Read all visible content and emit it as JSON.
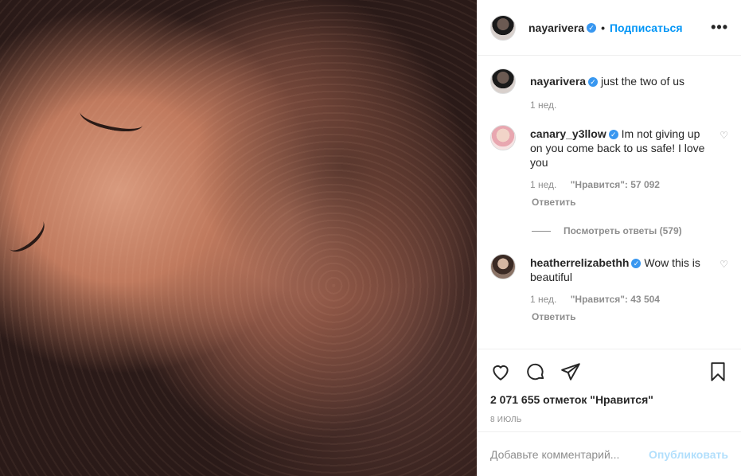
{
  "header": {
    "username": "nayarivera",
    "separator": "•",
    "follow_label": "Подписаться",
    "more": "•••"
  },
  "caption": {
    "username": "nayarivera",
    "text": "just the two of us",
    "time": "1 нед."
  },
  "comments": [
    {
      "username": "canary_y3llow",
      "text": "Im not giving up on you come back to us safe! I love you",
      "time": "1 нед.",
      "likes": "\"Нравится\": 57 092",
      "reply": "Ответить",
      "view_replies": "Посмотреть ответы (579)"
    },
    {
      "username": "heatherrelizabethh",
      "text": "Wow this is beautiful",
      "time": "1 нед.",
      "likes": "\"Нравится\": 43 504",
      "reply": "Ответить"
    }
  ],
  "likes_count": "2 071 655 отметок \"Нравится\"",
  "post_date": "8 ИЮЛЬ",
  "add_comment": {
    "placeholder": "Добавьте комментарий...",
    "publish_label": "Опубликовать"
  },
  "colors": {
    "accent": "#0095f6",
    "verified": "#3897f0",
    "muted": "#8e8e8e",
    "publish_disabled": "#b2dffc"
  },
  "icons": [
    "heart-icon",
    "comment-icon",
    "share-icon",
    "bookmark-icon",
    "verified-badge-icon",
    "more-icon"
  ]
}
